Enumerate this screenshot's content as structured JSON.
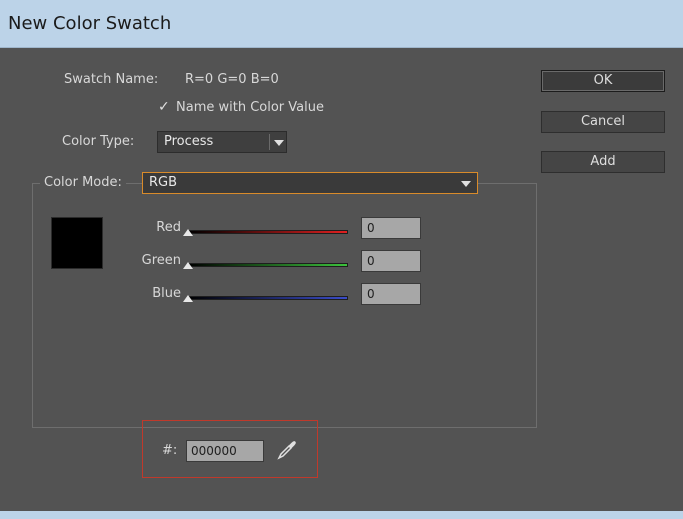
{
  "window": {
    "title": "New Color Swatch"
  },
  "swatch_name": {
    "label": "Swatch Name:",
    "value": "R=0 G=0 B=0"
  },
  "name_with_color_value": {
    "check_glyph": "✓",
    "label": "Name with Color Value",
    "checked": true
  },
  "color_type": {
    "label": "Color Type:",
    "value": "Process"
  },
  "color_mode": {
    "label": "Color Mode:",
    "value": "RGB"
  },
  "preview_color": "#000000",
  "sliders": [
    {
      "label": "Red",
      "value": "0",
      "level": 0,
      "gradient_end": "#e02020"
    },
    {
      "label": "Green",
      "value": "0",
      "level": 0,
      "gradient_end": "#3cc23c"
    },
    {
      "label": "Blue",
      "value": "0",
      "level": 0,
      "gradient_end": "#3a4cc8"
    }
  ],
  "hex": {
    "label": "#:",
    "value": "000000"
  },
  "buttons": {
    "ok": "OK",
    "cancel": "Cancel",
    "add": "Add"
  },
  "colors": {
    "highlight_border": "#c0392b",
    "focus_border": "#d98b2a"
  }
}
